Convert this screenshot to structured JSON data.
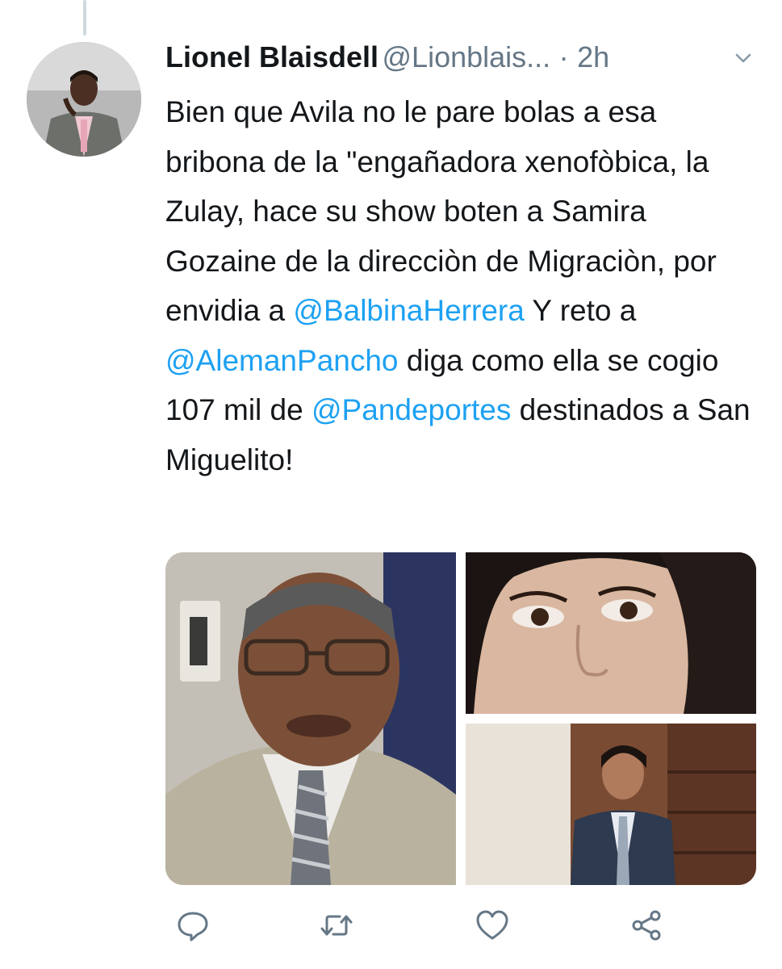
{
  "tweet": {
    "author_name": "Lionel Blaisdell",
    "author_handle": "@Lionblais...",
    "separator": "·",
    "time_ago": "2h",
    "text_parts": [
      {
        "type": "text",
        "value": "Bien que Avila no le pare bolas a esa bribona de la \"engañadora xenofòbica, la Zulay, hace su show boten a Samira Gozaine de la direcciòn de Migraciòn, por envidia a "
      },
      {
        "type": "mention",
        "value": "@BalbinaHerrera"
      },
      {
        "type": "text",
        "value": " Y reto a "
      },
      {
        "type": "mention",
        "value": "@AlemanPancho"
      },
      {
        "type": "text",
        "value": " diga como ella se cogio 107 mil de "
      },
      {
        "type": "mention",
        "value": "@Pandeportes"
      },
      {
        "type": "text",
        "value": " destinados a San Miguelito!"
      }
    ],
    "media": [
      {
        "name": "photo-man-glasses"
      },
      {
        "name": "photo-woman-closeup"
      },
      {
        "name": "photo-man-courtroom"
      }
    ]
  },
  "colors": {
    "text": "#14171a",
    "secondary": "#657786",
    "link": "#1da1f2",
    "icon": "#657786"
  },
  "icons": {
    "more": "chevron-down-icon",
    "reply": "reply-icon",
    "retweet": "retweet-icon",
    "like": "heart-icon",
    "share": "share-icon"
  }
}
